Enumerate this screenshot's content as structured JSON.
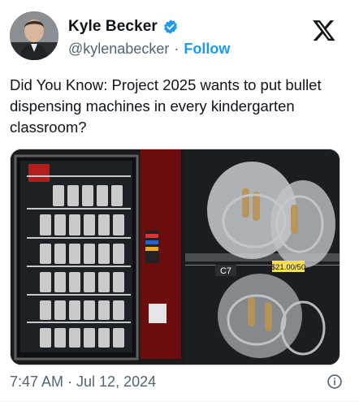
{
  "author": {
    "display_name": "Kyle Becker",
    "handle": "@kylenabecker",
    "separator": "·",
    "follow_label": "Follow",
    "verified": true
  },
  "tweet": {
    "text": "Did You Know: Project 2025 wants to put bullet dispensing machines in every kindergarten classroom?"
  },
  "media": {
    "left_panel_slot_label": "C7",
    "price_label": "$21.00/50"
  },
  "footer": {
    "timestamp": "7:47 AM · Jul 12, 2024"
  },
  "colors": {
    "accent": "#1d9bf0",
    "muted": "#536471",
    "text": "#0f1419"
  },
  "icons": {
    "platform": "x-logo-icon",
    "verified": "verified-badge-icon",
    "info": "info-icon"
  }
}
